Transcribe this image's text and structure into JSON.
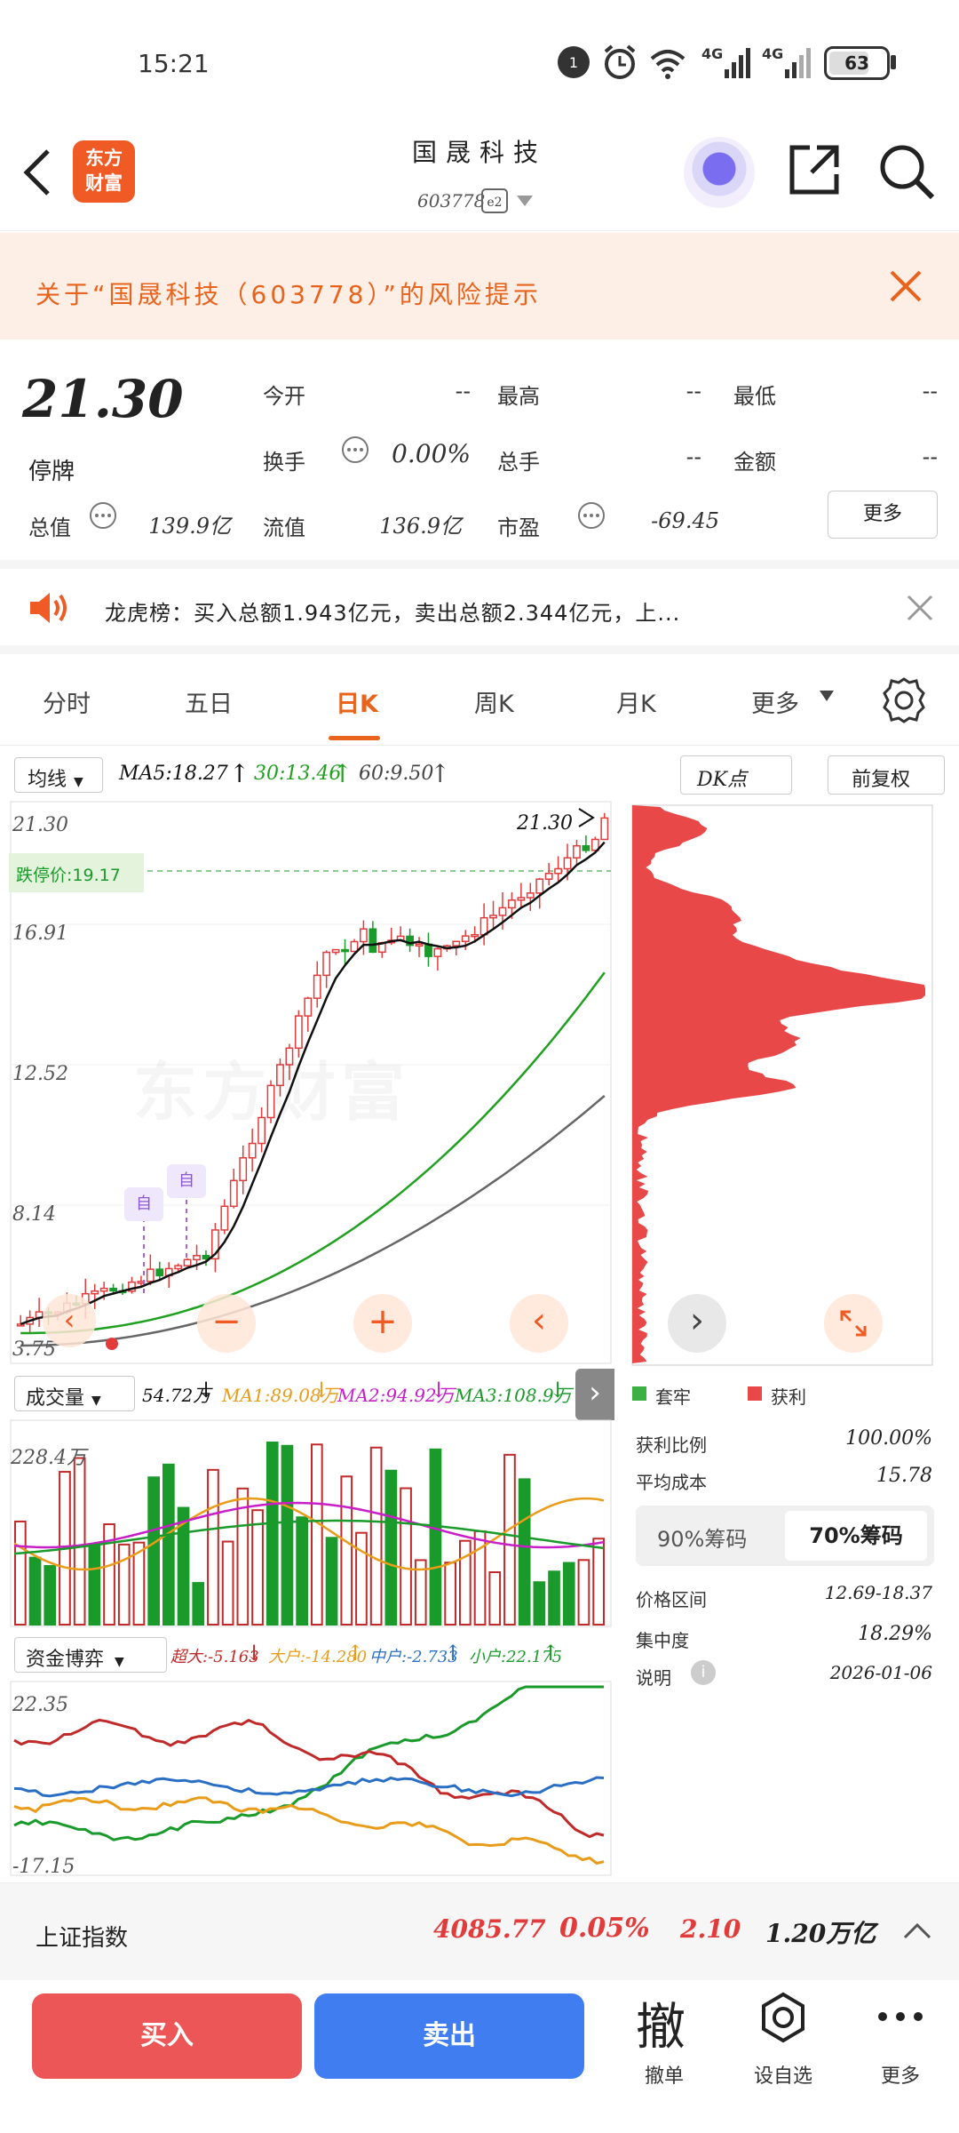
{
  "status": {
    "time": "15:21",
    "battery": "63"
  },
  "header": {
    "logo_line1": "东方",
    "logo_line2": "财富",
    "title": "国晟科技",
    "code": "603778"
  },
  "risk_banner": {
    "text": "关于“国晟科技（603778）”的风险提示"
  },
  "quote": {
    "price": "21.30",
    "status": "停牌",
    "open_label": "今开",
    "open_value": "--",
    "high_label": "最高",
    "high_value": "--",
    "low_label": "最低",
    "low_value": "--",
    "turnover_label": "换手",
    "turnover_value": "0.00%",
    "volume_label": "总手",
    "volume_value": "--",
    "amount_label": "金额",
    "amount_value": "--",
    "mktcap_label": "总值",
    "mktcap_value": "139.9亿",
    "float_label": "流值",
    "float_value": "136.9亿",
    "pe_label": "市盈",
    "pe_value": "-69.45",
    "more": "更多"
  },
  "news": {
    "text": "龙虎榜：买入总额1.943亿元，卖出总额2.344亿元，上..."
  },
  "tabs": [
    "分时",
    "五日",
    "日K",
    "周K",
    "月K",
    "更多"
  ],
  "chart_controls": {
    "ma_select": "均线",
    "ma5": "MA5:18.27",
    "ma30": "30:13.46",
    "ma60": "60:9.50",
    "dk": "DK点",
    "adjust": "前复权",
    "price_top": "21.30",
    "price_2": "16.91",
    "price_3": "12.52",
    "price_4": "8.14",
    "price_5": "3.75",
    "last_price_tag": "21.30",
    "limit_down": "跌停价:19.17",
    "mark_self": "自",
    "wm_text": "东方财富"
  },
  "volume": {
    "select": "成交量",
    "vol": "54.72万",
    "ma1": "MA1:89.08万",
    "ma2": "MA2:94.92万",
    "ma3": "MA3:108.9万",
    "max": "228.4万"
  },
  "fund_flow": {
    "select": "资金博弈",
    "super": "超大:-5.163",
    "big": "大户:-14.280",
    "mid": "中户:-2.733",
    "small": "小户:22.175",
    "top": "22.35",
    "bottom": "-17.15"
  },
  "chips": {
    "legend_trapped": "套牢",
    "legend_profit": "获利",
    "profit_ratio_label": "获利比例",
    "profit_ratio": "100.00%",
    "avg_cost_label": "平均成本",
    "avg_cost": "15.78",
    "tab90": "90%筹码",
    "tab70": "70%筹码",
    "range_label": "价格区间",
    "range": "12.69-18.37",
    "concentration_label": "集中度",
    "concentration": "18.29%",
    "note_label": "说明",
    "date": "2026-01-06"
  },
  "index_bar": {
    "name": "上证指数",
    "value": "4085.77",
    "pct": "0.05%",
    "change": "2.10",
    "amount": "1.20万亿"
  },
  "bottom": {
    "buy": "买入",
    "sell": "卖出",
    "cancel_icon_text": "撤",
    "cancel": "撤单",
    "watchlist": "设自选",
    "more": "更多"
  },
  "colors": {
    "up": "#e23b3b",
    "down": "#1a9a2a",
    "accent": "#e8631c",
    "ma5": "#111111",
    "ma30": "#1fa01f",
    "ma60": "#666666"
  }
}
